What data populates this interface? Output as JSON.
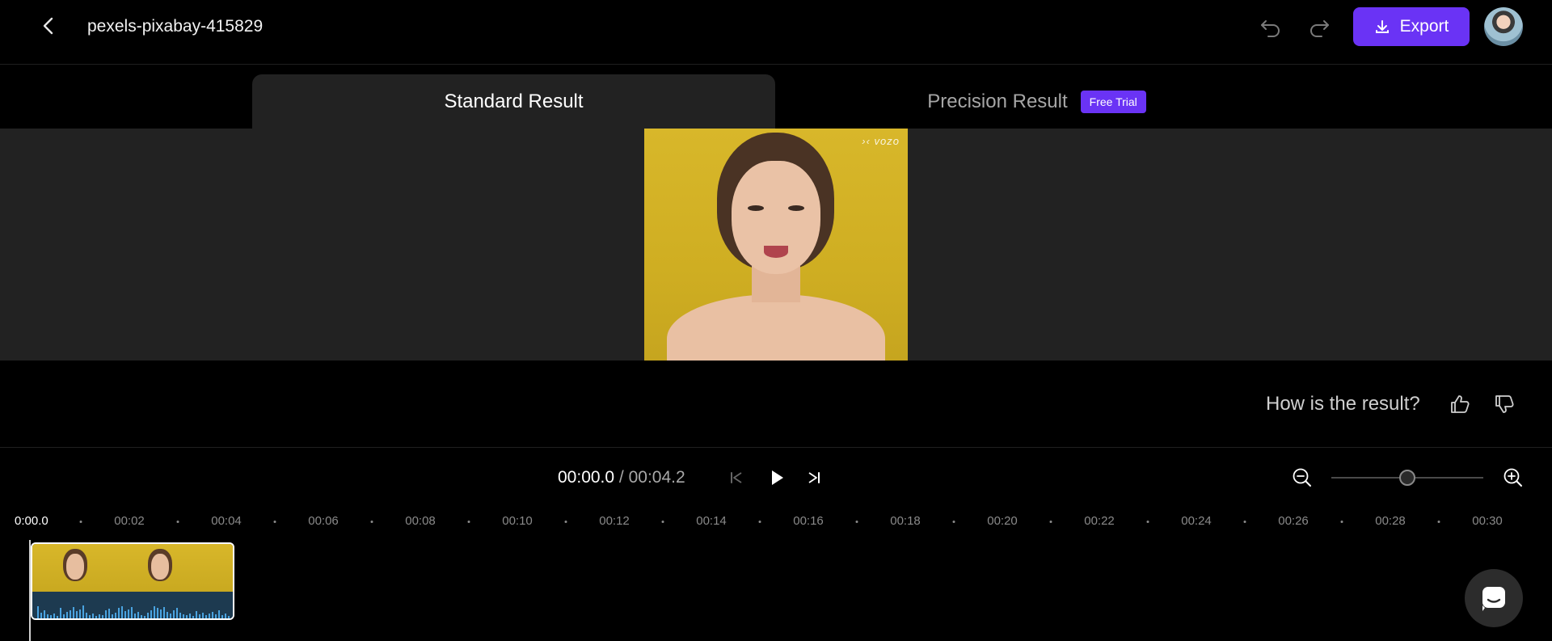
{
  "header": {
    "back_icon": "chevron-left-icon",
    "file_title": "pexels-pixabay-415829",
    "undo_icon": "undo-icon",
    "redo_icon": "redo-icon",
    "export_label": "Export",
    "export_icon": "download-icon",
    "accent": "#6a33f5"
  },
  "tabs": {
    "standard_label": "Standard Result",
    "precision_label": "Precision Result",
    "free_trial_badge": "Free Trial"
  },
  "preview": {
    "watermark": "vozo"
  },
  "feedback": {
    "question": "How is the result?",
    "thumbs_up_icon": "thumbs-up-icon",
    "thumbs_down_icon": "thumbs-down-icon"
  },
  "playback": {
    "current_time": "00:00.0",
    "separator": "/",
    "total_time": "00:04.2",
    "zoom_level": 0.5
  },
  "ruler": {
    "current": "0:00.0",
    "labels": [
      "00:02",
      "00:04",
      "00:06",
      "00:08",
      "00:10",
      "00:12",
      "00:14",
      "00:16",
      "00:18",
      "00:20",
      "00:22",
      "00:24",
      "00:26",
      "00:28",
      "00:30"
    ]
  },
  "chat": {
    "icon": "chat-icon"
  }
}
